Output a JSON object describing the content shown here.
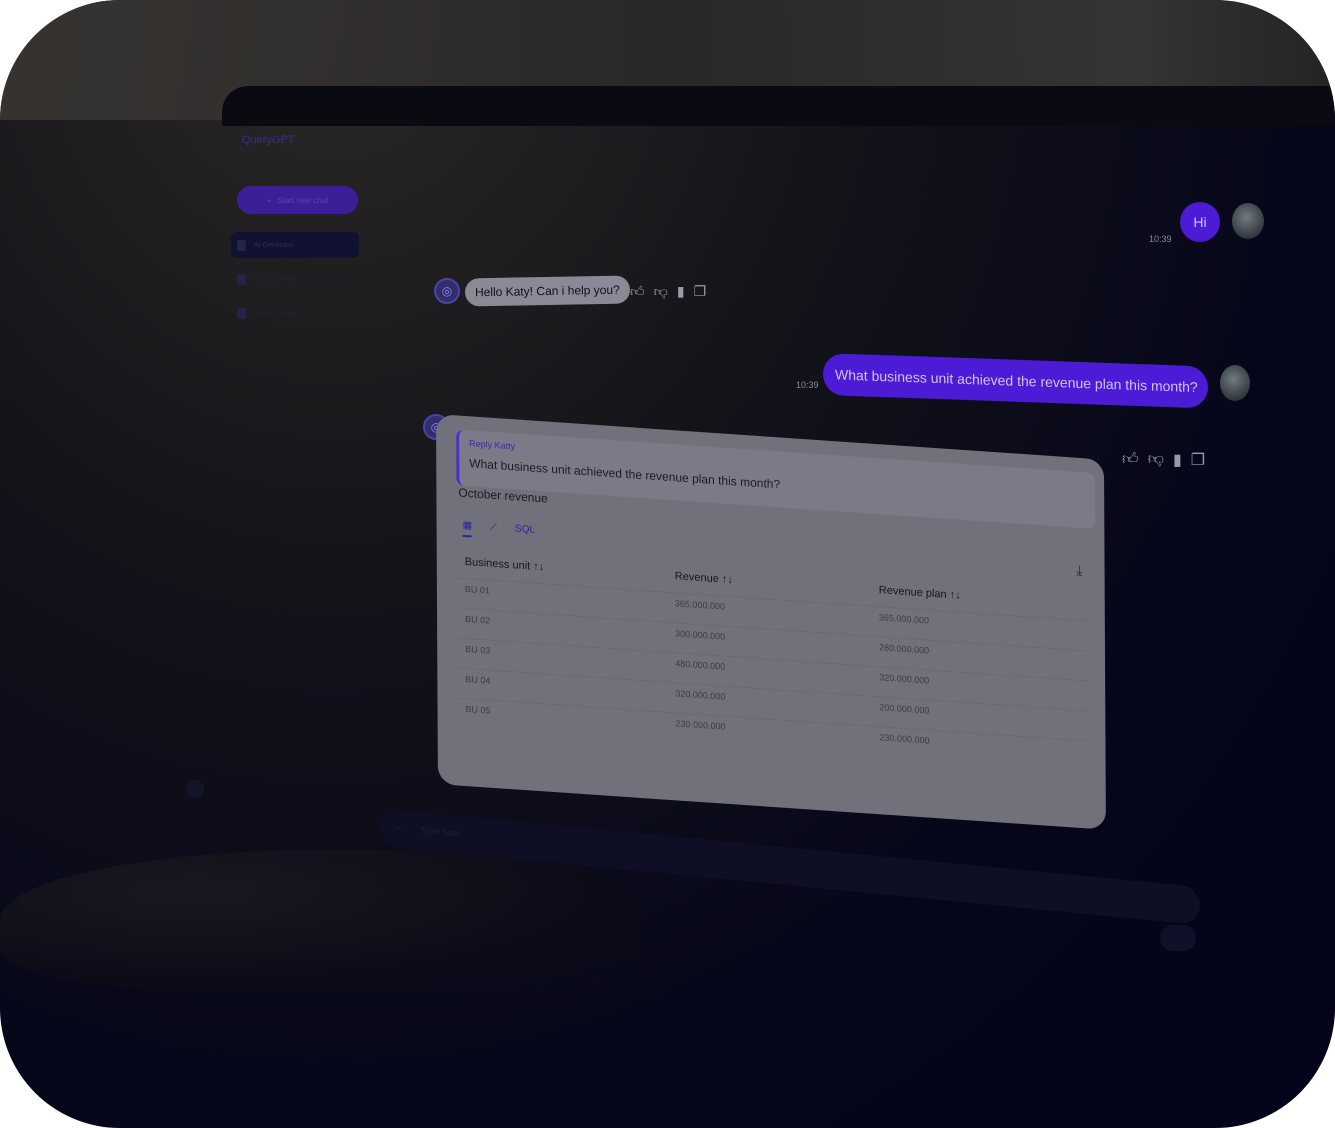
{
  "app": {
    "logo_text": "QueryGPT",
    "new_chat_label": "Start new chat",
    "nav_items": [
      {
        "label": "AI Generator"
      },
      {
        "label": "Data Schema"
      },
      {
        "label": "Saved answers"
      }
    ],
    "composer_placeholder": "Type here",
    "accent_color": "#4c1bd6"
  },
  "chat": {
    "messages": [
      {
        "role": "user",
        "text": "Hi",
        "time": "10:39"
      },
      {
        "role": "assistant",
        "text": "Hello Katy! Can i help you?"
      },
      {
        "role": "user",
        "text": "What business unit achieved the revenue plan this month?",
        "time": "10:39"
      },
      {
        "role": "assistant",
        "reply_label": "Reply Katty",
        "reply_quote": "What business unit achieved the revenue plan this month?",
        "title": "October revenue",
        "tabs": [
          "table-icon",
          "chart-icon",
          "SQL"
        ],
        "table": {
          "headers": [
            "Business unit",
            "Revenue",
            "Revenue plan"
          ],
          "rows": [
            [
              "BU 01",
              "365.000.000",
              "365.000.000"
            ],
            [
              "BU 02",
              "300.000.000",
              "280.000.000"
            ],
            [
              "BU 03",
              "480.000.000",
              "320.000.000"
            ],
            [
              "BU 04",
              "320.000.000",
              "200.000.000"
            ],
            [
              "BU 05",
              "230.000.000",
              "230.000.000"
            ]
          ]
        }
      }
    ]
  }
}
